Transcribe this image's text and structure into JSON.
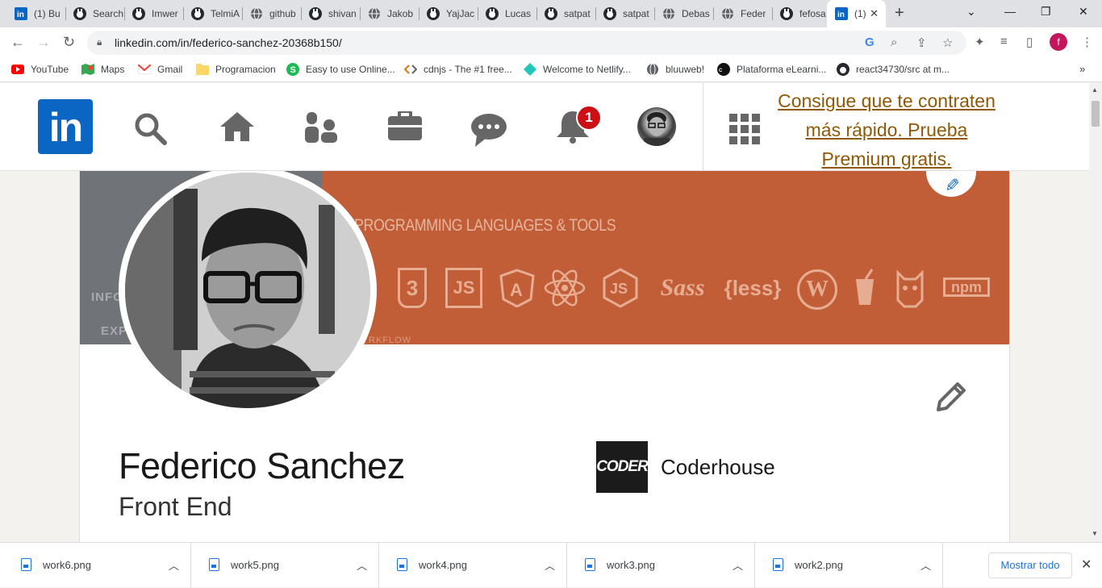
{
  "browser": {
    "tabs": [
      {
        "title": "(1) Bu",
        "icon": "linkedin-icon"
      },
      {
        "title": "Search",
        "icon": "github-icon"
      },
      {
        "title": "Imwer",
        "icon": "github-icon"
      },
      {
        "title": "TelmiA",
        "icon": "github-icon"
      },
      {
        "title": "github",
        "icon": "globe-icon"
      },
      {
        "title": "shivan",
        "icon": "github-icon"
      },
      {
        "title": "Jakob",
        "icon": "globe-icon"
      },
      {
        "title": "YajJac",
        "icon": "github-icon"
      },
      {
        "title": "Lucas",
        "icon": "github-icon"
      },
      {
        "title": "satpat",
        "icon": "github-icon"
      },
      {
        "title": "satpat",
        "icon": "github-icon"
      },
      {
        "title": "Debas",
        "icon": "globe-icon"
      },
      {
        "title": "Feder",
        "icon": "globe-icon"
      },
      {
        "title": "fefosa",
        "icon": "github-icon"
      }
    ],
    "active_tab": {
      "title": "(1)",
      "icon": "linkedin-icon"
    },
    "url": "linkedin.com/in/federico-sanchez-20368b150/",
    "profile_initial": "f",
    "bookmarks": [
      {
        "label": "YouTube",
        "icon": "youtube-icon"
      },
      {
        "label": "Maps",
        "icon": "maps-icon"
      },
      {
        "label": "Gmail",
        "icon": "gmail-icon"
      },
      {
        "label": "Programacion",
        "icon": "folder-icon"
      },
      {
        "label": "Easy to use Online...",
        "icon": "s-icon"
      },
      {
        "label": "cdnjs - The #1 free...",
        "icon": "code-icon"
      },
      {
        "label": "Welcome to Netlify...",
        "icon": "netlify-icon"
      },
      {
        "label": "bluuweb!",
        "icon": "globe-icon"
      },
      {
        "label": "Plataforma eLearni...",
        "icon": "coder-icon"
      },
      {
        "label": "react34730/src at m...",
        "icon": "github-icon"
      }
    ]
  },
  "linkedin": {
    "logo_text": "in",
    "notification_count": "1",
    "premium_cta": "Consigue que te contraten más rápido. Prueba Premium gratis.",
    "banner": {
      "title": "PROGRAMMING LANGUAGES & TOOLS",
      "left_texts": [
        "INFO",
        "EXP"
      ],
      "footer_text": "RKFLOW",
      "tech_labels": [
        "3",
        "JS",
        "A",
        "JS",
        "Sass",
        "{less}",
        "W",
        "npm"
      ]
    },
    "profile": {
      "name": "Federico Sanchez",
      "headline": "Front End",
      "company_logo_text": "CODER",
      "company_name": "Coderhouse"
    },
    "colors": {
      "brand": "#0a66c2",
      "banner": "#c25e37",
      "badge": "#cc1016",
      "premium": "#915907"
    }
  },
  "downloads": {
    "files": [
      "work6.png",
      "work5.png",
      "work4.png",
      "work3.png",
      "work2.png"
    ],
    "show_all": "Mostrar todo"
  }
}
